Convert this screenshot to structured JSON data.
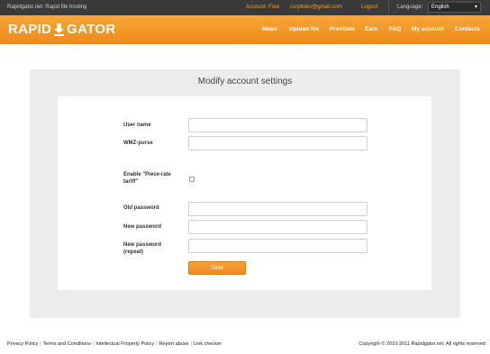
{
  "topbar": {
    "tagline": "Rapidgator.net: Rapid file hosting",
    "account": "Account: Free",
    "email": "corpitdev@gmail.com",
    "logout": "Logout",
    "language_label": "Language:",
    "language_value": "English"
  },
  "header": {
    "logo_left": "RAPID",
    "logo_right": "GATOR",
    "nav": [
      "News",
      "Upload file",
      "Premium",
      "Earn",
      "FAQ",
      "My account",
      "Contacts"
    ]
  },
  "panel": {
    "title": "Modify account settings",
    "fields": {
      "user_name": "User name",
      "wmz_purse": "WMZ-purse",
      "piece_rate_1": "Enable \"Piece-rate",
      "piece_rate_2": "tariff\"",
      "old_password": "Old password",
      "new_password": "New password",
      "new_password_repeat_1": "New password",
      "new_password_repeat_2": "(repeat)"
    },
    "save_label": "Save"
  },
  "footer": {
    "links": [
      "Privacy Policy",
      "Terms and Conditions",
      "Intellectual Property Policy",
      "Report abuse",
      "Link checker"
    ],
    "copyright": "Copyright © 2010-2011 Rapidgator.net. All rights reserved"
  },
  "colors": {
    "accent": "#f39b22",
    "topbar": "#3a3a3a"
  }
}
